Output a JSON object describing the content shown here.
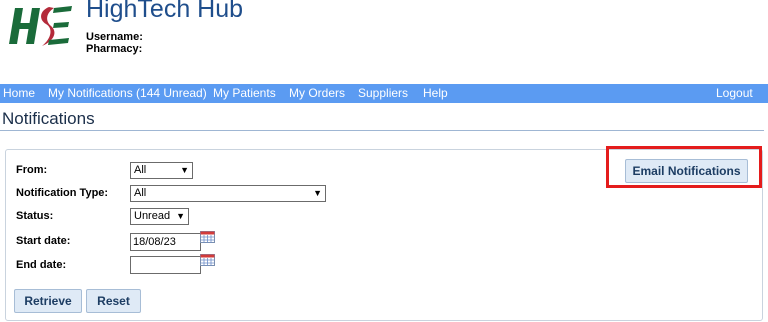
{
  "app": {
    "title": "HighTech Hub",
    "username_label": "Username:",
    "pharmacy_label": "Pharmacy:"
  },
  "nav": {
    "items": [
      "Home",
      "My Notifications (144 Unread)",
      "My Patients",
      "My Orders",
      "Suppliers",
      "Help"
    ],
    "logout": "Logout"
  },
  "page": {
    "title": "Notifications"
  },
  "filters": {
    "from": {
      "label": "From:",
      "value": "All"
    },
    "notification_type": {
      "label": "Notification Type:",
      "value": "All"
    },
    "status": {
      "label": "Status:",
      "value": "Unread"
    },
    "start_date": {
      "label": "Start date:",
      "value": "18/08/23"
    },
    "end_date": {
      "label": "End date:",
      "value": ""
    }
  },
  "buttons": {
    "retrieve": "Retrieve",
    "reset": "Reset",
    "email_notifications": "Email Notifications"
  },
  "colors": {
    "nav_bar": "#5b9bf2",
    "brand_green": "#1a6b3a",
    "brand_red": "#b42a3a",
    "title_blue": "#1f4e8c",
    "highlight": "#e41c1c"
  },
  "icons": {
    "logo": "hse-logo",
    "calendar": "calendar-icon",
    "dropdown": "chevron-down-icon"
  }
}
